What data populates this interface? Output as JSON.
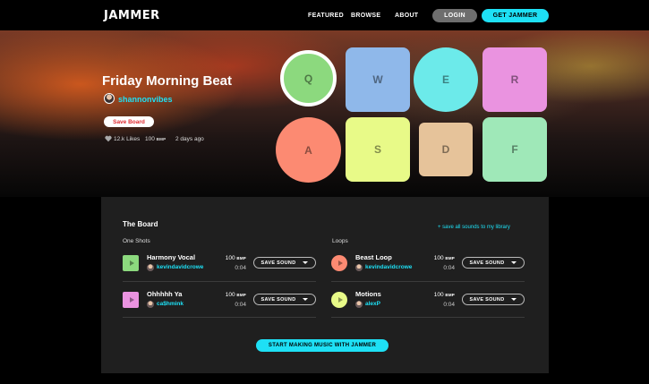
{
  "nav": {
    "logo": "JAMMER",
    "links": [
      "FEATURED",
      "BROWSE",
      "ABOUT"
    ],
    "login_label": "LOGIN",
    "get_label": "GET JAMMER"
  },
  "hero": {
    "title": "Friday Morning Beat",
    "user": "shannonvibes",
    "save_board_label": "Save Board",
    "likes": "12.k Likes",
    "bpm_value": "100",
    "bpm_unit": "BMP",
    "posted": "2 days ago"
  },
  "pads": [
    {
      "key": "Q",
      "color": "#8cd97e"
    },
    {
      "key": "W",
      "color": "#8fb8ea"
    },
    {
      "key": "E",
      "color": "#6ceaea"
    },
    {
      "key": "R",
      "color": "#ea93e0"
    },
    {
      "key": "A",
      "color": "#fc8a72"
    },
    {
      "key": "S",
      "color": "#e8fa88"
    },
    {
      "key": "D",
      "color": "#e6c39a"
    },
    {
      "key": "F",
      "color": "#9fe8b8"
    }
  ],
  "board": {
    "title": "The Board",
    "save_all_label": "+ save all sounds to my library",
    "one_shots_label": "One Shots",
    "loops_label": "Loops",
    "save_sound_label": "SAVE SOUND",
    "bpm_unit": "BMP",
    "one_shots": [
      {
        "name": "Harmony Vocal",
        "user": "kevindavidcrowe",
        "bpm": "100",
        "time": "0:04",
        "color": "#8cd97e"
      },
      {
        "name": "Ohhhhh Ya",
        "user": "ca$hmink",
        "bpm": "100",
        "time": "0:04",
        "color": "#ea93e0"
      }
    ],
    "loops": [
      {
        "name": "Beast Loop",
        "user": "kevindavidcrowe",
        "bpm": "100",
        "time": "0:04",
        "color": "#fc8a72"
      },
      {
        "name": "Motions",
        "user": "alexP",
        "bpm": "100",
        "time": "0:04",
        "color": "#e8fa88"
      }
    ],
    "cta_label": "START MAKING MUSIC WITH JAMMER"
  }
}
